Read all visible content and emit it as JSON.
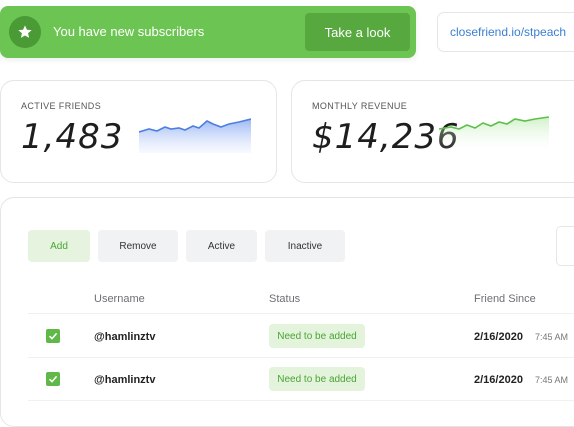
{
  "notification": {
    "icon": "star-icon",
    "text": "You have new subscribers",
    "action_label": "Take a look",
    "bg_color": "#6cc552"
  },
  "profile_link": {
    "text": "closefriend.io/stpeach"
  },
  "stats": {
    "active_friends": {
      "label": "ACTIVE FRIENDS",
      "value": "1,483",
      "trend_color": "#4d7fe0"
    },
    "monthly_revenue": {
      "label": "MONTHLY REVENUE",
      "value": "$14,236",
      "trend_color": "#5cc048"
    }
  },
  "filters": [
    {
      "label": "Add",
      "active": true
    },
    {
      "label": "Remove",
      "active": false
    },
    {
      "label": "Active",
      "active": false
    },
    {
      "label": "Inactive",
      "active": false
    }
  ],
  "table": {
    "columns": {
      "username": "Username",
      "status": "Status",
      "friend_since": "Friend Since"
    },
    "rows": [
      {
        "checked": true,
        "username": "@hamlinztv",
        "status": "Need to be added",
        "date": "2/16/2020",
        "time": "7:45 AM"
      },
      {
        "checked": true,
        "username": "@hamlinztv",
        "status": "Need to be added",
        "date": "2/16/2020",
        "time": "7:45 AM"
      }
    ]
  }
}
